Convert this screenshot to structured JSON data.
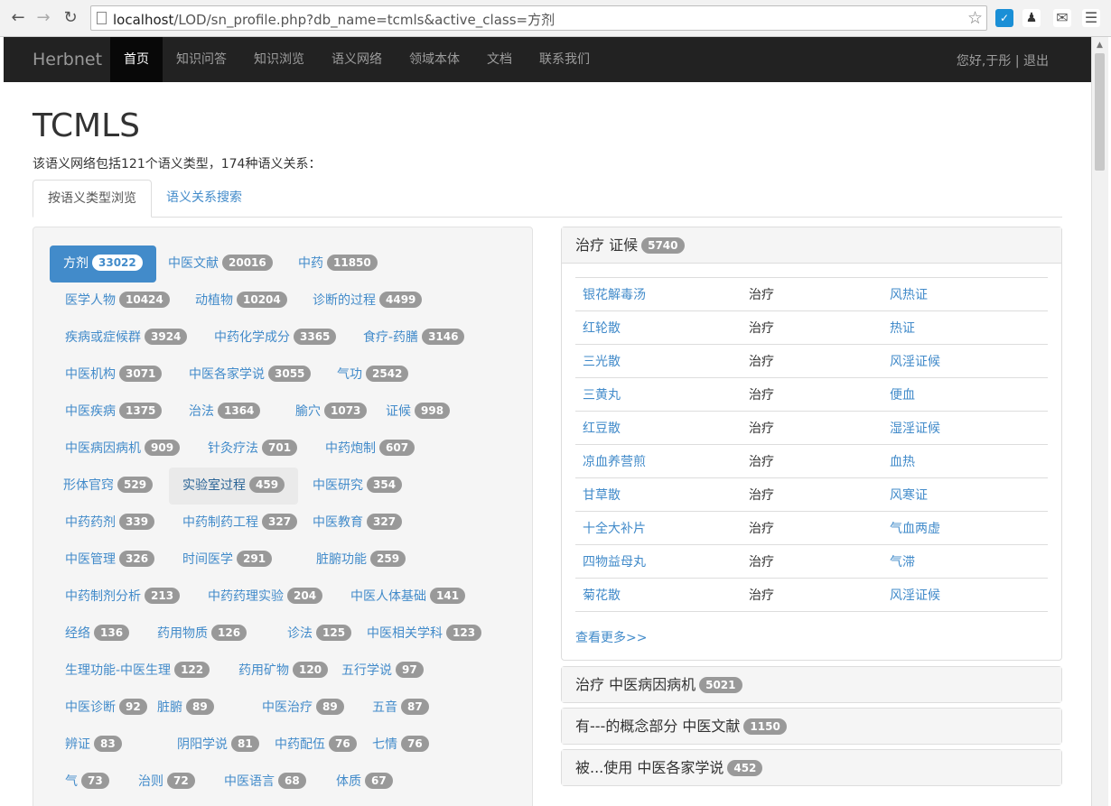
{
  "browser": {
    "url_host": "localhost",
    "url_path": "/LOD/sn_profile.php?db_name=tcmls&active_class=方剂"
  },
  "navbar": {
    "brand": "Herbnet",
    "items": [
      "首页",
      "知识问答",
      "知识浏览",
      "语义网络",
      "领域本体",
      "文档",
      "联系我们"
    ],
    "active_index": 0,
    "user": "您好,于彤 | 退出"
  },
  "title": "TCMLS",
  "description": "该语义网络包括121个语义类型，174种语义关系：",
  "tabs": [
    {
      "label": "按语义类型浏览",
      "active": true
    },
    {
      "label": "语义关系搜索",
      "active": false
    }
  ],
  "classes": [
    {
      "name": "方剂",
      "count": "33022"
    },
    {
      "name": "中医文献",
      "count": "20016"
    },
    {
      "name": "中药",
      "count": "11850"
    },
    {
      "name": "医学人物",
      "count": "10424"
    },
    {
      "name": "动植物",
      "count": "10204"
    },
    {
      "name": "诊断的过程",
      "count": "4499"
    },
    {
      "name": "疾病或症候群",
      "count": "3924"
    },
    {
      "name": "中药化学成分",
      "count": "3365"
    },
    {
      "name": "食疗-药膳",
      "count": "3146"
    },
    {
      "name": "中医机构",
      "count": "3071"
    },
    {
      "name": "中医各家学说",
      "count": "3055"
    },
    {
      "name": "气功",
      "count": "2542"
    },
    {
      "name": "中医疾病",
      "count": "1375"
    },
    {
      "name": "治法",
      "count": "1364"
    },
    {
      "name": "腧穴",
      "count": "1073"
    },
    {
      "name": "证候",
      "count": "998"
    },
    {
      "name": "中医病因病机",
      "count": "909"
    },
    {
      "name": "针灸疗法",
      "count": "701"
    },
    {
      "name": "中药炮制",
      "count": "607"
    },
    {
      "name": "形体官窍",
      "count": "529"
    },
    {
      "name": "实验室过程",
      "count": "459"
    },
    {
      "name": "中医研究",
      "count": "354"
    },
    {
      "name": "中药药剂",
      "count": "339"
    },
    {
      "name": "中药制药工程",
      "count": "327"
    },
    {
      "name": "中医教育",
      "count": "327"
    },
    {
      "name": "中医管理",
      "count": "326"
    },
    {
      "name": "时间医学",
      "count": "291"
    },
    {
      "name": "脏腑功能",
      "count": "259"
    },
    {
      "name": "中药制剂分析",
      "count": "213"
    },
    {
      "name": "中药药理实验",
      "count": "204"
    },
    {
      "name": "中医人体基础",
      "count": "141"
    },
    {
      "name": "经络",
      "count": "136"
    },
    {
      "name": "药用物质",
      "count": "126"
    },
    {
      "name": "诊法",
      "count": "125"
    },
    {
      "name": "中医相关学科",
      "count": "123"
    },
    {
      "name": "生理功能-中医生理",
      "count": "122"
    },
    {
      "name": "药用矿物",
      "count": "120"
    },
    {
      "name": "五行学说",
      "count": "97"
    },
    {
      "name": "中医诊断",
      "count": "92"
    },
    {
      "name": "脏腑",
      "count": "89"
    },
    {
      "name": "中医治疗",
      "count": "89"
    },
    {
      "name": "五音",
      "count": "87"
    },
    {
      "name": "辨证",
      "count": "83"
    },
    {
      "name": "阴阳学说",
      "count": "81"
    },
    {
      "name": "中药配伍",
      "count": "76"
    },
    {
      "name": "七情",
      "count": "76"
    },
    {
      "name": "气",
      "count": "73"
    },
    {
      "name": "治则",
      "count": "72"
    },
    {
      "name": "中医语言",
      "count": "68"
    },
    {
      "name": "体质",
      "count": "67"
    }
  ],
  "relations": [
    {
      "title": "治疗 证候",
      "count": "5740",
      "rows": [
        [
          "银花解毒汤",
          "治疗",
          "风热证"
        ],
        [
          "红轮散",
          "治疗",
          "热证"
        ],
        [
          "三光散",
          "治疗",
          "风淫证候"
        ],
        [
          "三黄丸",
          "治疗",
          "便血"
        ],
        [
          "红豆散",
          "治疗",
          "湿淫证候"
        ],
        [
          "凉血养营煎",
          "治疗",
          "血热"
        ],
        [
          "甘草散",
          "治疗",
          "风寒证"
        ],
        [
          "十全大补片",
          "治疗",
          "气血两虚"
        ],
        [
          "四物益母丸",
          "治疗",
          "气滞"
        ],
        [
          "菊花散",
          "治疗",
          "风淫证候"
        ]
      ],
      "more": "查看更多>>"
    },
    {
      "title": "治疗 中医病因病机",
      "count": "5021"
    },
    {
      "title": "有---的概念部分 中医文献",
      "count": "1150"
    },
    {
      "title": "被...使用 中医各家学说",
      "count": "452"
    }
  ]
}
